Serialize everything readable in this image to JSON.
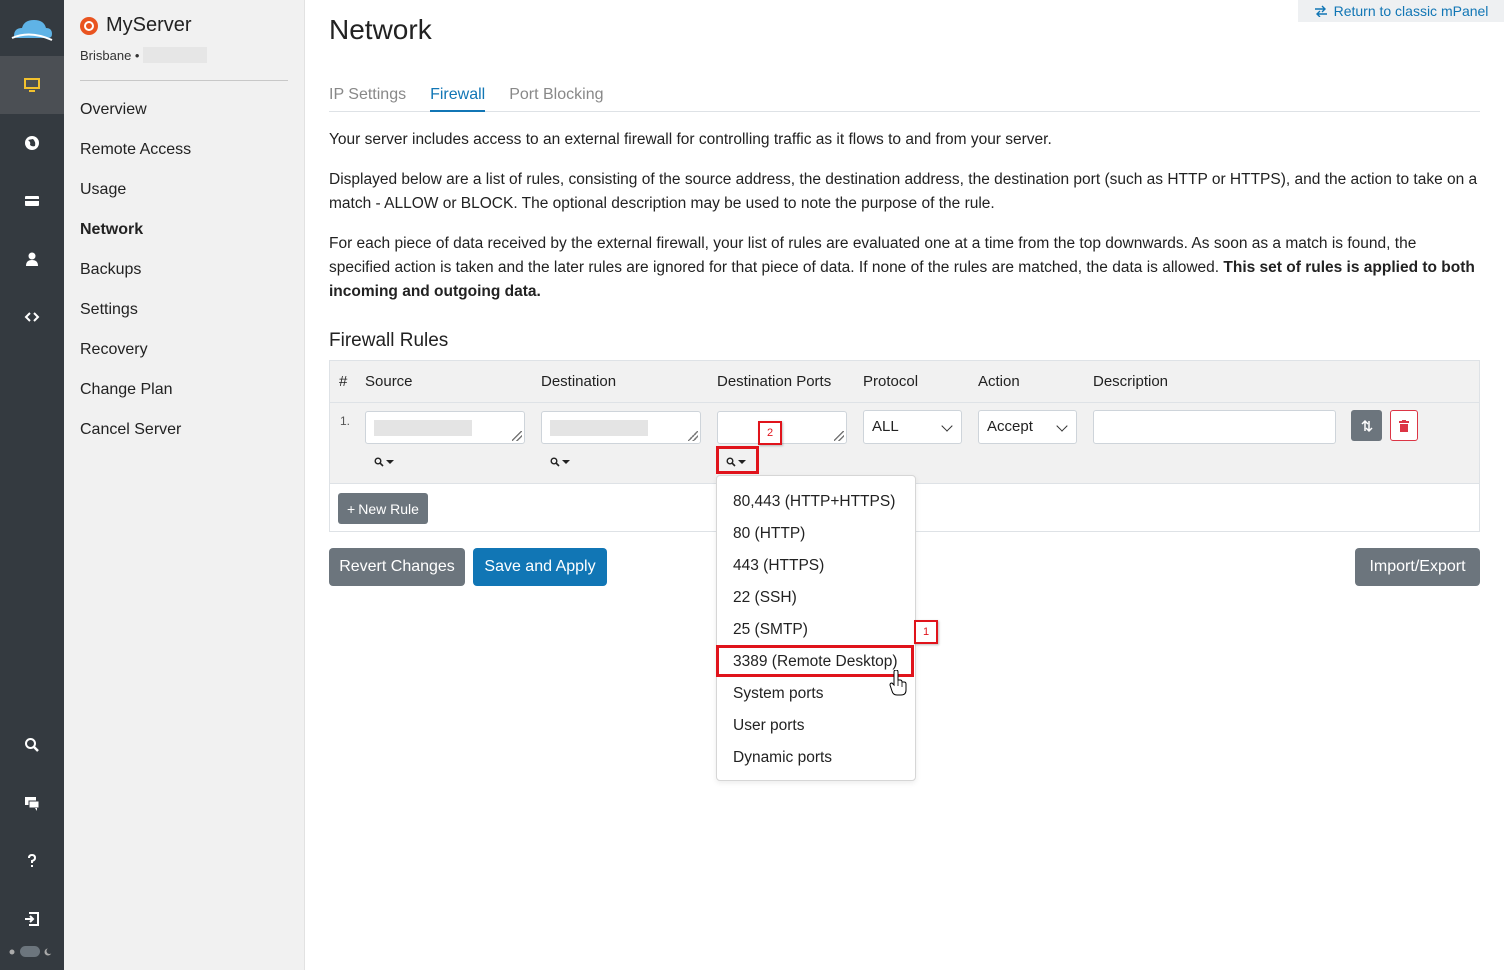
{
  "header": {
    "classic_link": "Return to classic mPanel"
  },
  "server": {
    "name": "MyServer",
    "location": "Brisbane •"
  },
  "sidebar": {
    "items": [
      {
        "label": "Overview"
      },
      {
        "label": "Remote Access"
      },
      {
        "label": "Usage"
      },
      {
        "label": "Network",
        "active": true
      },
      {
        "label": "Backups"
      },
      {
        "label": "Settings"
      },
      {
        "label": "Recovery"
      },
      {
        "label": "Change Plan"
      },
      {
        "label": "Cancel Server"
      }
    ]
  },
  "page": {
    "title": "Network"
  },
  "tabs": [
    {
      "label": "IP Settings"
    },
    {
      "label": "Firewall",
      "active": true
    },
    {
      "label": "Port Blocking"
    }
  ],
  "intro": {
    "p1": "Your server includes access to an external firewall for controlling traffic as it flows to and from your server.",
    "p2": "Displayed below are a list of rules, consisting of the source address, the destination address, the destination port (such as HTTP or HTTPS), and the action to take on a match - ALLOW or BLOCK. The optional description may be used to note the purpose of the rule.",
    "p3": "For each piece of data received by the external firewall, your list of rules are evaluated one at a time from the top downwards. As soon as a match is found, the specified action is taken and the later rules are ignored for that piece of data. If none of the rules are matched, the data is allowed.",
    "p3_bold": "This set of rules is applied to both incoming and outgoing data."
  },
  "rules": {
    "title": "Firewall Rules",
    "columns": [
      "#",
      "Source",
      "Destination",
      "Destination Ports",
      "Protocol",
      "Action",
      "Description"
    ],
    "rows": [
      {
        "num": "1.",
        "source": "",
        "destination": "",
        "ports": "",
        "protocol": "ALL",
        "action": "Accept",
        "description": ""
      }
    ],
    "new_rule_label": "New Rule"
  },
  "ports_dropdown": {
    "options": [
      "80,443 (HTTP+HTTPS)",
      "80 (HTTP)",
      "443 (HTTPS)",
      "22 (SSH)",
      "25 (SMTP)",
      "3389 (Remote Desktop)",
      "System ports",
      "User ports",
      "Dynamic ports"
    ],
    "highlighted": "3389 (Remote Desktop)"
  },
  "buttons": {
    "revert": "Revert Changes",
    "save": "Save and Apply",
    "import_export": "Import/Export"
  },
  "annotations": {
    "marker1": "1",
    "marker2": "2"
  },
  "colors": {
    "accent": "#1176b5",
    "rail": "#343a40",
    "highlight": "#e0131b",
    "danger": "#dc3545",
    "secondary": "#6c757d",
    "monitor_icon": "#f2c12e"
  }
}
